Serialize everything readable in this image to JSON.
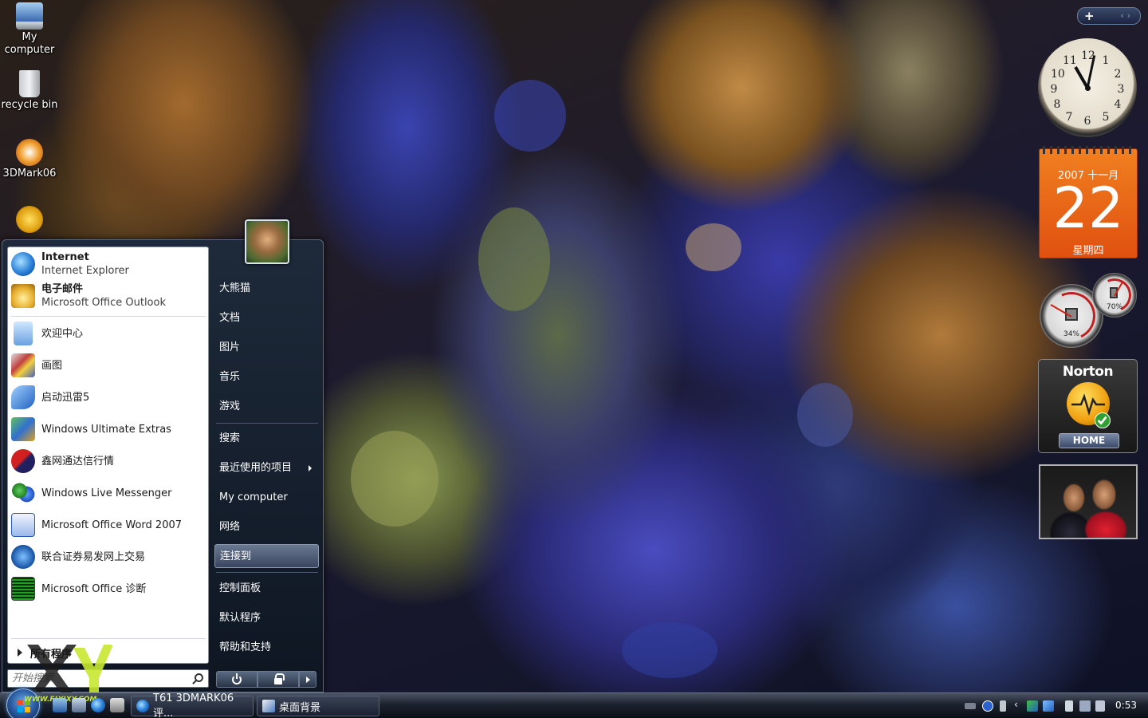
{
  "desktop": {
    "icons": [
      {
        "label": "My computer"
      },
      {
        "label": "recycle bin"
      },
      {
        "label": "3DMark06"
      },
      {
        "label": ""
      }
    ]
  },
  "start_menu": {
    "pinned": [
      {
        "title": "Internet",
        "subtitle": "Internet Explorer",
        "icon": "internet-explorer-icon"
      },
      {
        "title": "电子邮件",
        "subtitle": "Microsoft Office Outlook",
        "icon": "outlook-icon"
      }
    ],
    "recent": [
      {
        "label": "欢迎中心",
        "icon": "welcome-center-icon"
      },
      {
        "label": "画图",
        "icon": "paint-icon"
      },
      {
        "label": "启动迅雷5",
        "icon": "thunder-icon"
      },
      {
        "label": "Windows Ultimate Extras",
        "icon": "ultimate-extras-icon"
      },
      {
        "label": "鑫网通达信行情",
        "icon": "guosen-icon"
      },
      {
        "label": "Windows Live Messenger",
        "icon": "messenger-icon"
      },
      {
        "label": "Microsoft Office Word 2007",
        "icon": "word-icon"
      },
      {
        "label": "联合证券易发网上交易",
        "icon": "securities-icon"
      },
      {
        "label": "Microsoft Office 诊断",
        "icon": "office-diagnostics-icon"
      }
    ],
    "all_programs": "所有程序",
    "search_placeholder": "开始搜索",
    "right_items": [
      {
        "label": "大熊猫"
      },
      {
        "label": "文档"
      },
      {
        "label": "图片"
      },
      {
        "label": "音乐"
      },
      {
        "label": "游戏"
      },
      {
        "label": "搜索"
      },
      {
        "label": "最近使用的项目"
      },
      {
        "label": "My computer"
      },
      {
        "label": "网络"
      },
      {
        "label": "连接到"
      },
      {
        "label": "控制面板"
      },
      {
        "label": "默认程序"
      },
      {
        "label": "帮助和支持"
      }
    ]
  },
  "taskbar": {
    "watermark": "WWW.FLYIXY.COM",
    "tasks": [
      {
        "label": "T61 3DMARK06评..."
      },
      {
        "label": "桌面背景"
      }
    ],
    "clock": "0:53"
  },
  "gadgets": {
    "sidebar_add": "+",
    "calendar": {
      "year_month": "2007 十一月",
      "day": "22",
      "weekday": "星期四"
    },
    "meter": {
      "cpu": "34%",
      "memory": "70%"
    },
    "norton": {
      "brand": "Norton",
      "button": "HOME"
    }
  },
  "colors": {
    "calendar_orange": "#e85a14",
    "taskbar_dark": "#0a0e16",
    "start_pane_white": "#ffffff"
  }
}
